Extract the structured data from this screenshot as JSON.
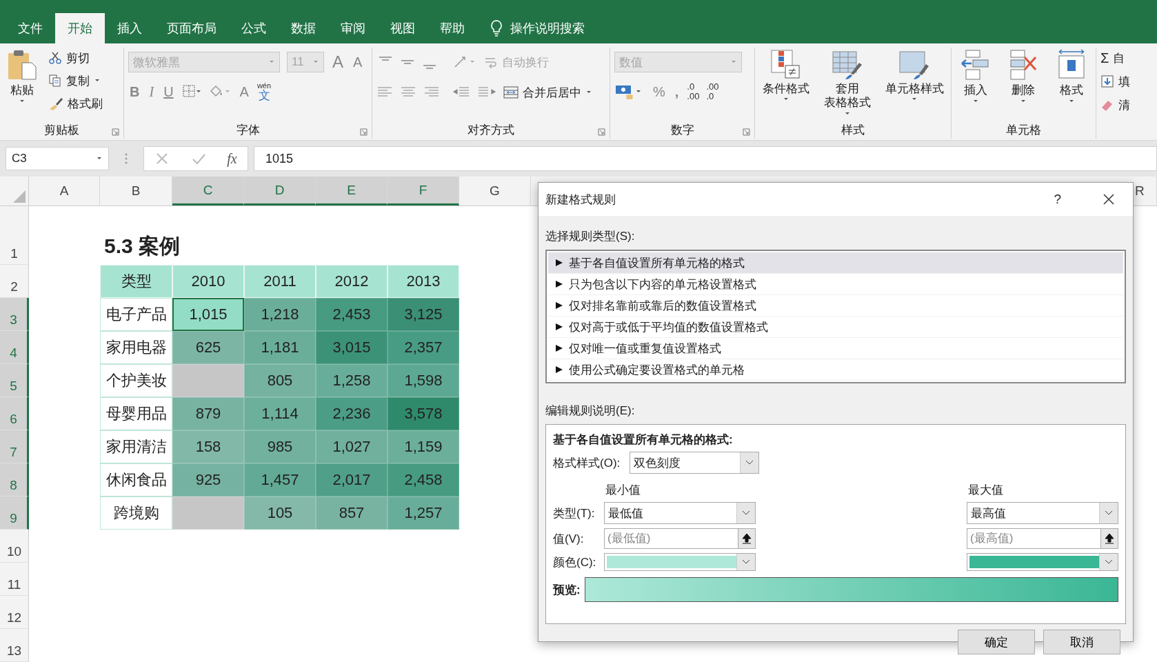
{
  "tabs": [
    {
      "label": "文件",
      "selected": false
    },
    {
      "label": "开始",
      "selected": true
    },
    {
      "label": "插入",
      "selected": false
    },
    {
      "label": "页面布局",
      "selected": false
    },
    {
      "label": "公式",
      "selected": false
    },
    {
      "label": "数据",
      "selected": false
    },
    {
      "label": "审阅",
      "selected": false
    },
    {
      "label": "视图",
      "selected": false
    },
    {
      "label": "帮助",
      "selected": false
    }
  ],
  "tell_me": "操作说明搜索",
  "ribbon": {
    "clipboard": {
      "paste": "粘贴",
      "cut": "剪切",
      "copy": "复制",
      "painter": "格式刷",
      "label": "剪贴板"
    },
    "font": {
      "name": "微软雅黑",
      "size": "11",
      "disabled": true,
      "grow": "A",
      "shrink": "A",
      "styles": [
        "B",
        "I",
        "U"
      ],
      "color_letter": "A",
      "phonetic_top": "wén",
      "phonetic": "文",
      "label": "字体"
    },
    "alignment": {
      "wrap": "自动换行",
      "wrap_disabled": true,
      "merge": "合并后居中",
      "label": "对齐方式"
    },
    "number": {
      "format": "数值",
      "disabled": true,
      "percent": "%",
      "comma": ",",
      "decimals": [
        {
          "top": ".0",
          "bottom": ".00"
        },
        {
          "top": ".00",
          "bottom": ".0"
        }
      ],
      "label": "数字"
    },
    "styles": {
      "buttons": [
        {
          "lines": [
            "条件格式"
          ]
        },
        {
          "lines": [
            "套用",
            "表格格式"
          ]
        },
        {
          "lines": [
            "单元格样式"
          ]
        }
      ],
      "label": "样式"
    },
    "cells": {
      "buttons": [
        "插入",
        "删除",
        "格式"
      ],
      "label": "单元格"
    },
    "editing": {
      "sigma": "Σ",
      "items": [
        "自",
        "填",
        "清"
      ]
    }
  },
  "formula_bar": {
    "name_box": "C3",
    "fx": "fx",
    "value": "1015"
  },
  "columns": [
    {
      "label": "A",
      "selected": false
    },
    {
      "label": "B",
      "selected": false
    },
    {
      "label": "C",
      "selected": true
    },
    {
      "label": "D",
      "selected": true
    },
    {
      "label": "E",
      "selected": true
    },
    {
      "label": "F",
      "selected": true
    },
    {
      "label": "G",
      "selected": false
    },
    {
      "label": "R",
      "selected": false
    }
  ],
  "row_headers": [
    {
      "label": "1",
      "selected": false
    },
    {
      "label": "2",
      "selected": false
    },
    {
      "label": "3",
      "selected": true
    },
    {
      "label": "4",
      "selected": true
    },
    {
      "label": "5",
      "selected": true
    },
    {
      "label": "6",
      "selected": true
    },
    {
      "label": "7",
      "selected": true
    },
    {
      "label": "8",
      "selected": true
    },
    {
      "label": "9",
      "selected": true
    },
    {
      "label": "10",
      "selected": false
    },
    {
      "label": "11",
      "selected": false
    },
    {
      "label": "12",
      "selected": false
    },
    {
      "label": "13",
      "selected": false
    }
  ],
  "sheet": {
    "title": "5.3 案例",
    "header": [
      "类型",
      "2010",
      "2011",
      "2012",
      "2013"
    ],
    "rows": [
      {
        "label": "电子产品",
        "cells": [
          {
            "value": "1,015",
            "color": "#93dcc5"
          },
          {
            "value": "1,218",
            "color": "#6aae9a"
          },
          {
            "value": "2,453",
            "color": "#469b81"
          },
          {
            "value": "3,125",
            "color": "#3a8f75"
          }
        ]
      },
      {
        "label": "家用电器",
        "cells": [
          {
            "value": "625",
            "color": "#7cb5a4"
          },
          {
            "value": "1,181",
            "color": "#6aae9a"
          },
          {
            "value": "3,015",
            "color": "#3c9277"
          },
          {
            "value": "2,357",
            "color": "#489c83"
          }
        ]
      },
      {
        "label": "个护美妆",
        "cells": [
          {
            "color": "#c6c6c6"
          },
          {
            "value": "805",
            "color": "#75b2a0"
          },
          {
            "value": "1,258",
            "color": "#68ad99"
          },
          {
            "value": "1,598",
            "color": "#5da893"
          }
        ]
      },
      {
        "label": "母婴用品",
        "cells": [
          {
            "value": "879",
            "color": "#78b3a2"
          },
          {
            "value": "1,114",
            "color": "#6cb09b"
          },
          {
            "value": "2,236",
            "color": "#4b9d85"
          },
          {
            "value": "3,578",
            "color": "#2f8a6c"
          }
        ]
      },
      {
        "label": "家用清洁",
        "cells": [
          {
            "value": "158",
            "color": "#82b8a8"
          },
          {
            "value": "985",
            "color": "#71b19e"
          },
          {
            "value": "1,027",
            "color": "#70b09d"
          },
          {
            "value": "1,159",
            "color": "#6baf9a"
          }
        ]
      },
      {
        "label": "休闲食品",
        "cells": [
          {
            "value": "925",
            "color": "#76b2a1"
          },
          {
            "value": "1,457",
            "color": "#62aa95"
          },
          {
            "value": "2,017",
            "color": "#509f88"
          },
          {
            "value": "2,458",
            "color": "#469b81"
          }
        ]
      },
      {
        "label": "跨境购",
        "cells": [
          {
            "color": "#c6c6c6"
          },
          {
            "value": "105",
            "color": "#84b9a9"
          },
          {
            "value": "857",
            "color": "#78b3a2"
          },
          {
            "value": "1,257",
            "color": "#68ad99"
          }
        ]
      }
    ]
  },
  "dialog": {
    "title": "新建格式规则",
    "help": "?",
    "select_label": "选择规则类型(S):",
    "rule_types": [
      {
        "label": "基于各自值设置所有单元格的格式",
        "selected": true
      },
      {
        "label": "只为包含以下内容的单元格设置格式",
        "selected": false
      },
      {
        "label": "仅对排名靠前或靠后的数值设置格式",
        "selected": false
      },
      {
        "label": "仅对高于或低于平均值的数值设置格式",
        "selected": false
      },
      {
        "label": "仅对唯一值或重复值设置格式",
        "selected": false
      },
      {
        "label": "使用公式确定要设置格式的单元格",
        "selected": false
      }
    ],
    "edit_label": "编辑规则说明(E):",
    "desc_title": "基于各自值设置所有单元格的格式:",
    "format_style_label": "格式样式(O):",
    "format_style": "双色刻度",
    "type_label": "类型(T):",
    "value_label": "值(V):",
    "color_label": "颜色(C):",
    "min": {
      "heading": "最小值",
      "type": "最低值",
      "placeholder": "(最低值)",
      "color": "#aee8d8"
    },
    "max": {
      "heading": "最大值",
      "type": "最高值",
      "placeholder": "(最高值)",
      "color": "#3ab795"
    },
    "preview_label": "预览:",
    "buttons": [
      "确定",
      "取消"
    ]
  }
}
